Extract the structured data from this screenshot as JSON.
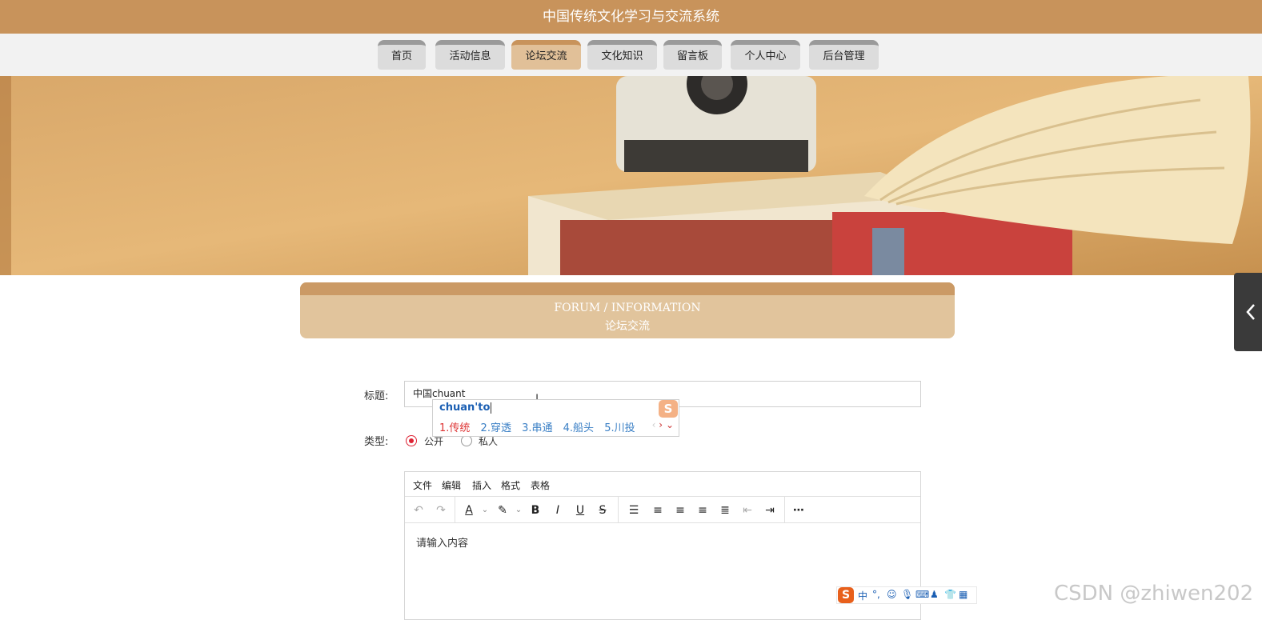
{
  "header": {
    "site_title": "中国传统文化学习与交流系统"
  },
  "nav": {
    "items": [
      {
        "label": "首页"
      },
      {
        "label": "活动信息"
      },
      {
        "label": "论坛交流"
      },
      {
        "label": "文化知识"
      },
      {
        "label": "留言板"
      },
      {
        "label": "个人中心"
      },
      {
        "label": "后台管理"
      }
    ],
    "active": "论坛交流"
  },
  "section": {
    "title_en": "FORUM / INFORMATION",
    "title_cn": "论坛交流"
  },
  "form": {
    "title_label": "标题:",
    "title_value": "中国chuant",
    "type_label": "类型:",
    "type_options": [
      {
        "label": "公开",
        "selected": true
      },
      {
        "label": "私人",
        "selected": false
      }
    ]
  },
  "ime": {
    "composition": "chuan'to",
    "candidates": [
      "1.传统",
      "2.穿透",
      "3.串通",
      "4.船头",
      "5.川投"
    ],
    "logo": "S"
  },
  "editor": {
    "menus": [
      "文件",
      "编辑",
      "插入",
      "格式",
      "表格"
    ],
    "toolbar_icons": [
      "undo-icon",
      "redo-icon",
      "text-color-icon",
      "highlight-icon",
      "bold-icon",
      "italic-icon",
      "underline-icon",
      "strikethrough-icon",
      "line-height-icon",
      "align-left-icon",
      "align-center-icon",
      "align-right-icon",
      "align-justify-icon",
      "outdent-icon",
      "indent-icon",
      "more-icon"
    ],
    "placeholder": "请输入内容"
  },
  "ime_bar": {
    "mode": "中"
  },
  "watermark": "CSDN @zhiwen202",
  "colors": {
    "brand": "#c8935b",
    "active_tab": "#e1c098",
    "section_head": "#e1c49c",
    "accent_red": "#d23"
  }
}
